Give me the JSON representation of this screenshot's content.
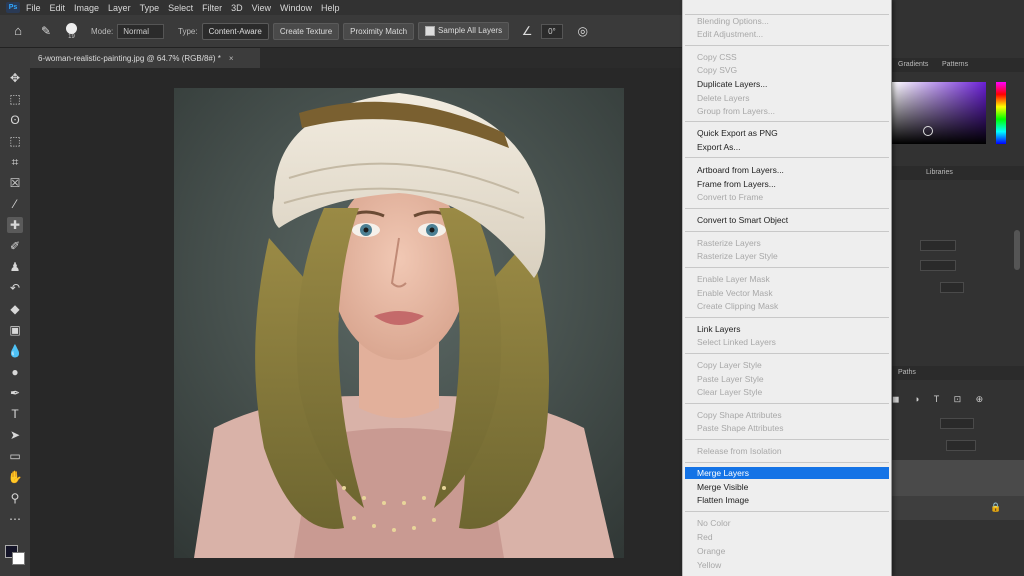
{
  "menubar": {
    "logo": "Ps",
    "items": [
      "File",
      "Edit",
      "Image",
      "Layer",
      "Type",
      "Select",
      "Filter",
      "3D",
      "View",
      "Window",
      "Help"
    ]
  },
  "options": {
    "brush_size": "19",
    "mode_label": "Mode:",
    "mode_value": "Normal",
    "type_label": "Type:",
    "type_buttons": [
      "Content-Aware",
      "Create Texture",
      "Proximity Match"
    ],
    "sample_all_layers": "Sample All Layers",
    "angle_value": "0°"
  },
  "document_tab": {
    "title": "6-woman-realistic-painting.jpg @ 64.7% (RGB/8#) *",
    "close": "×"
  },
  "right_panel": {
    "tabs_top": [
      "Gradients",
      "Patterns"
    ],
    "tabs_mid": [
      "Libraries"
    ],
    "tabs_layers": [
      "Paths"
    ]
  },
  "context_menu": {
    "items": [
      {
        "label": "Blending Options...",
        "enabled": false
      },
      {
        "label": "Edit Adjustment...",
        "enabled": false
      },
      {
        "label": "Copy CSS",
        "enabled": false
      },
      {
        "label": "Copy SVG",
        "enabled": false
      },
      {
        "label": "Duplicate Layers...",
        "enabled": true
      },
      {
        "label": "Delete Layers",
        "enabled": false
      },
      {
        "label": "Group from Layers...",
        "enabled": false
      },
      {
        "label": "Quick Export as PNG",
        "enabled": true
      },
      {
        "label": "Export As...",
        "enabled": true
      },
      {
        "label": "Artboard from Layers...",
        "enabled": true
      },
      {
        "label": "Frame from Layers...",
        "enabled": true
      },
      {
        "label": "Convert to Frame",
        "enabled": false
      },
      {
        "label": "Convert to Smart Object",
        "enabled": true
      },
      {
        "label": "Rasterize Layers",
        "enabled": false
      },
      {
        "label": "Rasterize Layer Style",
        "enabled": false
      },
      {
        "label": "Enable Layer Mask",
        "enabled": false
      },
      {
        "label": "Enable Vector Mask",
        "enabled": false
      },
      {
        "label": "Create Clipping Mask",
        "enabled": false
      },
      {
        "label": "Link Layers",
        "enabled": true
      },
      {
        "label": "Select Linked Layers",
        "enabled": false
      },
      {
        "label": "Copy Layer Style",
        "enabled": false
      },
      {
        "label": "Paste Layer Style",
        "enabled": false
      },
      {
        "label": "Clear Layer Style",
        "enabled": false
      },
      {
        "label": "Copy Shape Attributes",
        "enabled": false
      },
      {
        "label": "Paste Shape Attributes",
        "enabled": false
      },
      {
        "label": "Release from Isolation",
        "enabled": false
      },
      {
        "label": "Merge Layers",
        "enabled": true,
        "highlighted": true
      },
      {
        "label": "Merge Visible",
        "enabled": true
      },
      {
        "label": "Flatten Image",
        "enabled": true
      },
      {
        "label": "No Color",
        "enabled": false
      },
      {
        "label": "Red",
        "enabled": false
      },
      {
        "label": "Orange",
        "enabled": false
      },
      {
        "label": "Yellow",
        "enabled": false
      }
    ]
  },
  "colors": {
    "accent": "#1473e6",
    "foreground_swatch": "#141428",
    "background_swatch": "#ffffff"
  }
}
